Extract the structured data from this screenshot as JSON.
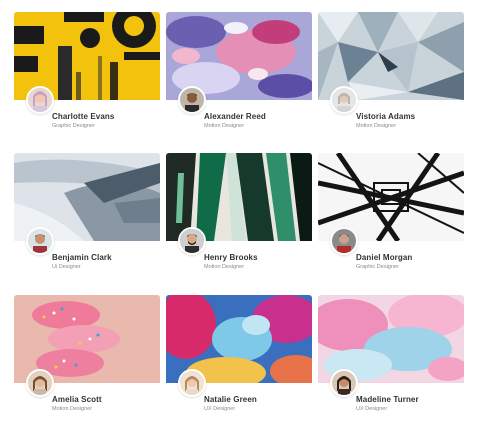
{
  "cards": [
    {
      "name": "Charlotte Evans",
      "role": "Graphic Designer",
      "thumb_icon": "yellow-abstract-painting",
      "avatar_icon": "person-avatar"
    },
    {
      "name": "Alexander Reed",
      "role": "Motion Designer",
      "thumb_icon": "marbled-fluid-art",
      "avatar_icon": "person-avatar"
    },
    {
      "name": "Vistoria Adams",
      "role": "Motion Designer",
      "thumb_icon": "geometric-facets",
      "avatar_icon": "person-avatar"
    },
    {
      "name": "Benjamin Clark",
      "role": "Ui Designer",
      "thumb_icon": "grey-brush-texture",
      "avatar_icon": "person-avatar"
    },
    {
      "name": "Henry Brooks",
      "role": "Motion Designer",
      "thumb_icon": "green-paint-streaks",
      "avatar_icon": "person-avatar"
    },
    {
      "name": "Daniel Morgan",
      "role": "Graphic Designer",
      "thumb_icon": "black-steel-structure",
      "avatar_icon": "person-avatar"
    },
    {
      "name": "Amelia Scott",
      "role": "Motion Designer",
      "thumb_icon": "sprinkle-spiral",
      "avatar_icon": "person-avatar"
    },
    {
      "name": "Natalie Green",
      "role": "UX Designer",
      "thumb_icon": "colorful-smoke",
      "avatar_icon": "person-avatar"
    },
    {
      "name": "Madeline Turner",
      "role": "UX Designer",
      "thumb_icon": "pink-blue-watercolor",
      "avatar_icon": "person-avatar"
    }
  ]
}
